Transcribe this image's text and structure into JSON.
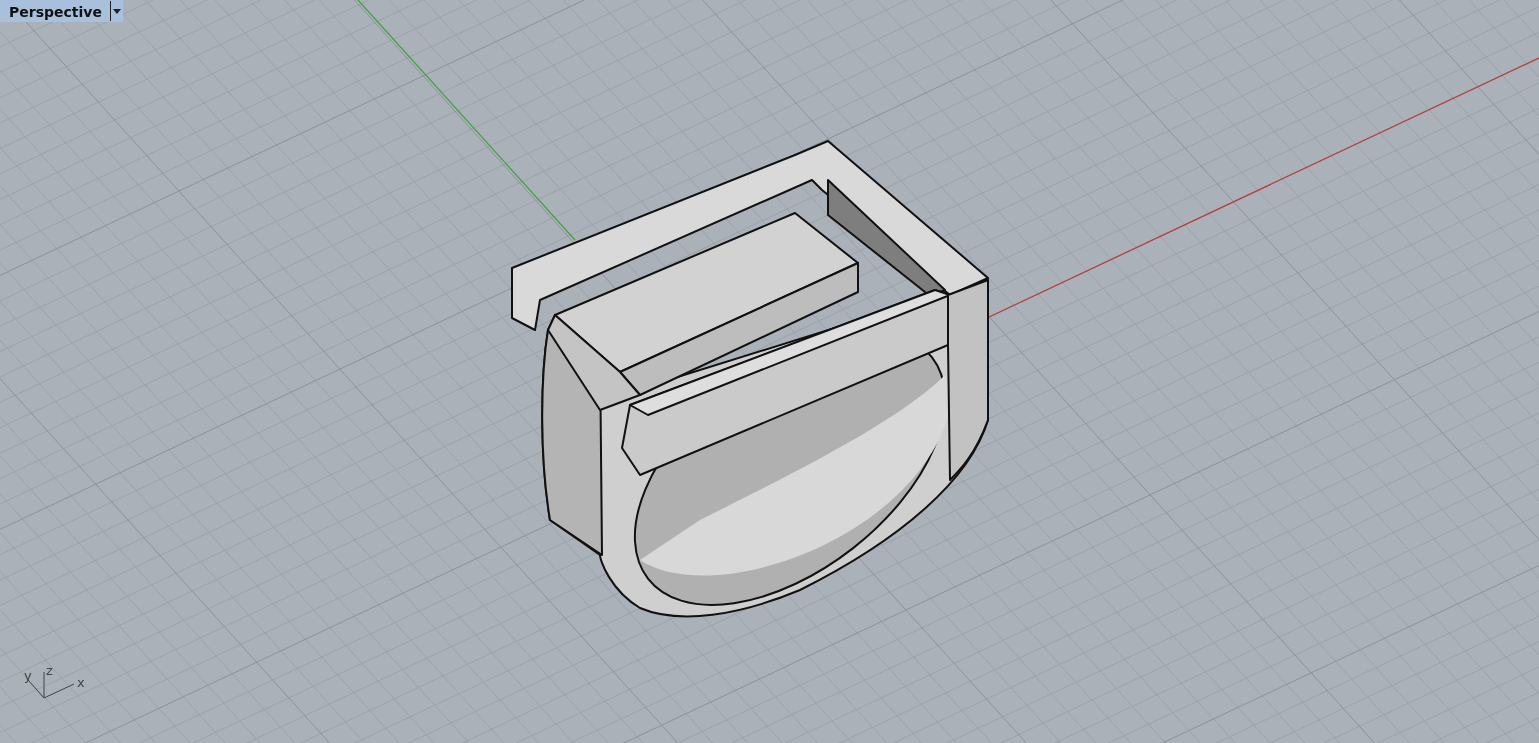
{
  "viewport": {
    "title": "Perspective"
  },
  "axis_widget": {
    "x_label": "x",
    "y_label": "y",
    "z_label": "z"
  }
}
